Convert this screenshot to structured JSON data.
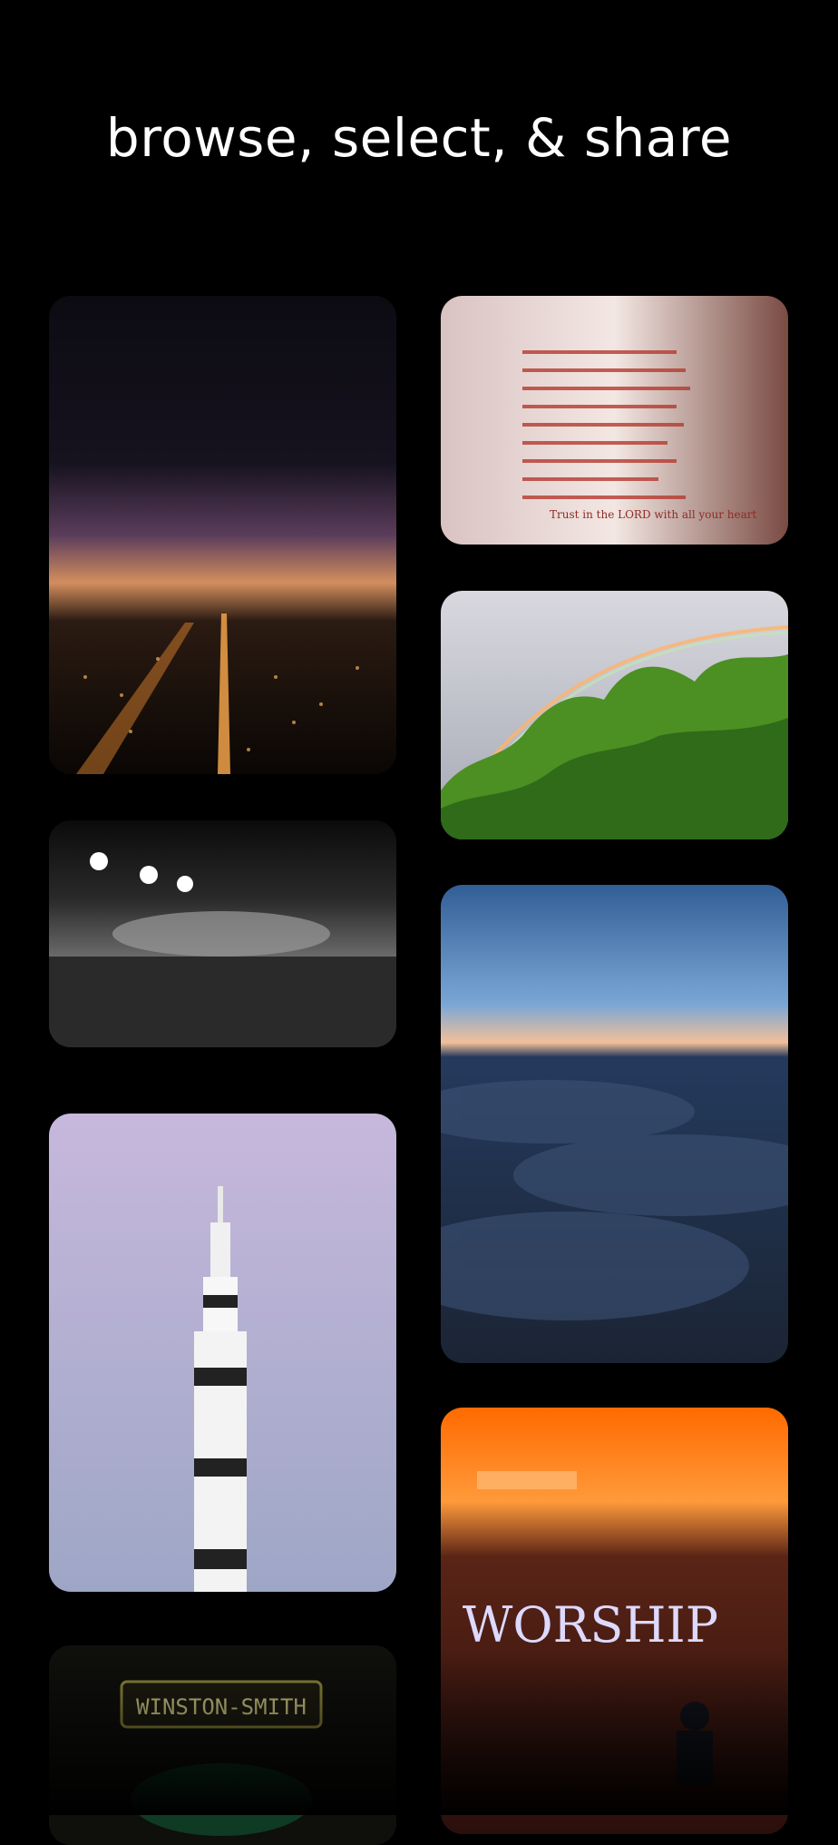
{
  "header": {
    "title": "browse, select, & share"
  },
  "gallery": {
    "items": [
      {
        "subject": "city lights at night",
        "text": ""
      },
      {
        "subject": "open bible page",
        "text": "Trust in the LORD with all your heart"
      },
      {
        "subject": "rainbow over trees",
        "text": ""
      },
      {
        "subject": "stadium crowd black and white",
        "text": ""
      },
      {
        "subject": "sky above clouds at dusk",
        "text": ""
      },
      {
        "subject": "rocket against lavender sky",
        "text": ""
      },
      {
        "subject": "worship room with orange light",
        "text": "WORSHIP"
      },
      {
        "subject": "neon sign",
        "text": "WINSTON-SMITH"
      }
    ]
  },
  "colors": {
    "background": "#000000",
    "title": "#ffffff"
  }
}
